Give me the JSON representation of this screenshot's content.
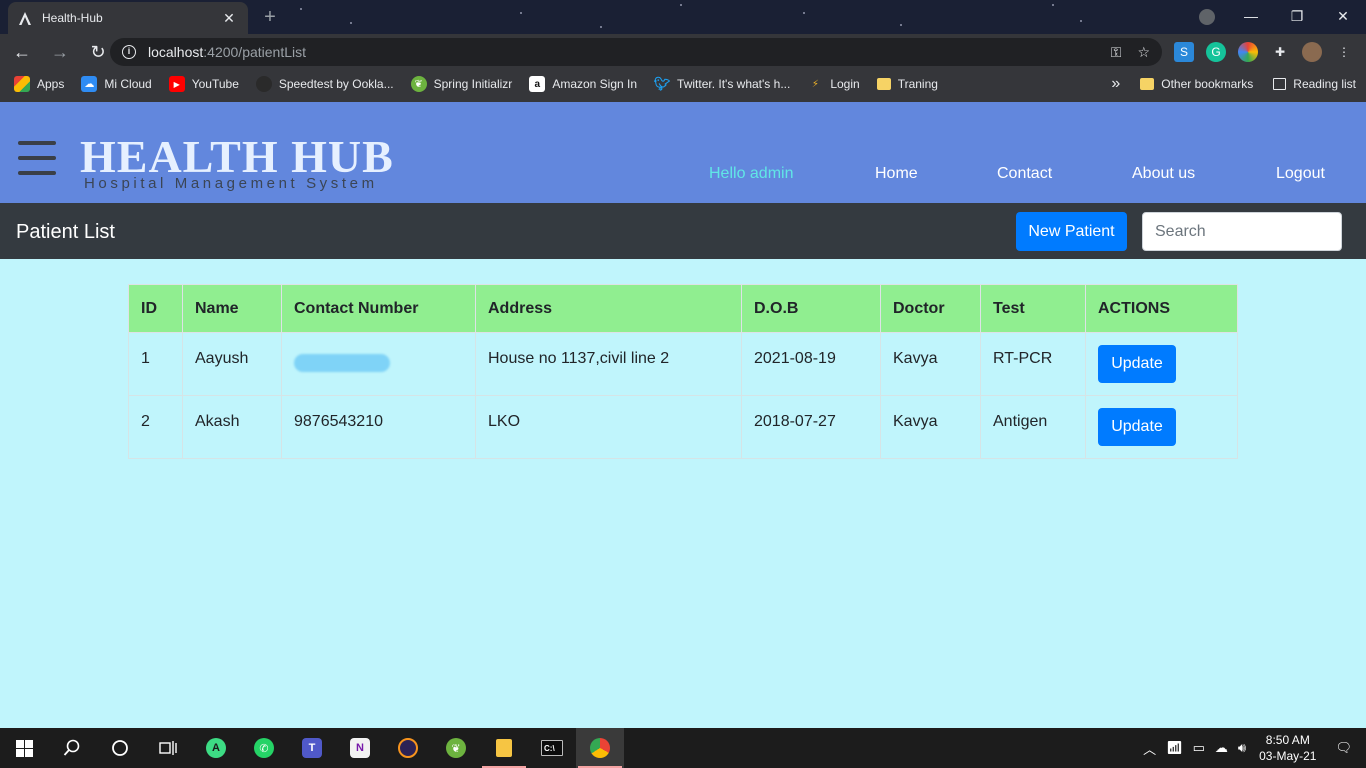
{
  "browser": {
    "tab_title": "Health-Hub",
    "new_tab_symbol": "+",
    "url_host": "localhost",
    "url_path": ":4200/patientList",
    "bookmarks": [
      {
        "label": "Apps",
        "icon": "apps-grid-icon",
        "color": "#e94235"
      },
      {
        "label": "Mi Cloud",
        "icon": "mi-cloud-icon",
        "color": "#2f8cf3"
      },
      {
        "label": "YouTube",
        "icon": "youtube-icon",
        "color": "#ff0000"
      },
      {
        "label": "Speedtest by Ookla...",
        "icon": "speedtest-icon",
        "color": "#2a2a2a"
      },
      {
        "label": "Spring Initializr",
        "icon": "spring-icon",
        "color": "#6db33f"
      },
      {
        "label": "Amazon Sign In",
        "icon": "amazon-icon",
        "color": "#ffffff"
      },
      {
        "label": "Twitter. It's what's h...",
        "icon": "twitter-icon",
        "color": "#1da1f2"
      },
      {
        "label": "Login",
        "icon": "login-icon",
        "color": "#f0b429"
      },
      {
        "label": "Traning",
        "icon": "folder-icon",
        "color": "#f6d365"
      }
    ],
    "bookmarks_overflow": "»",
    "other_bookmarks": "Other bookmarks",
    "reading_list": "Reading list"
  },
  "app": {
    "brand_title": "HEALTH HUB",
    "brand_subtitle": "Hospital Management System",
    "nav": {
      "hello": "Hello admin",
      "home": "Home",
      "contact": "Contact",
      "about": "About us",
      "logout": "Logout"
    },
    "page_title": "Patient List",
    "new_patient_label": "New Patient",
    "search_placeholder": "Search",
    "table": {
      "headers": [
        "ID",
        "Name",
        "Contact Number",
        "Address",
        "D.O.B",
        "Doctor",
        "Test",
        "ACTIONS"
      ],
      "rows": [
        {
          "id": "1",
          "name": "Aayush",
          "contact": "",
          "address": "House no 1137,civil line 2",
          "dob": "2021-08-19",
          "doctor": "Kavya",
          "test": "RT-PCR",
          "action": "Update"
        },
        {
          "id": "2",
          "name": "Akash",
          "contact": "9876543210",
          "address": "LKO",
          "dob": "2018-07-27",
          "doctor": "Kavya",
          "test": "Antigen",
          "action": "Update"
        }
      ]
    }
  },
  "taskbar": {
    "time": "8:50 AM",
    "date": "03-May-21"
  },
  "colors": {
    "header_bg": "#6287dd",
    "subheader_bg": "#343a40",
    "page_bg": "#c0f5fc",
    "table_header_bg": "#90ee90",
    "primary": "#007bff",
    "hello_color": "#61e6e6"
  }
}
